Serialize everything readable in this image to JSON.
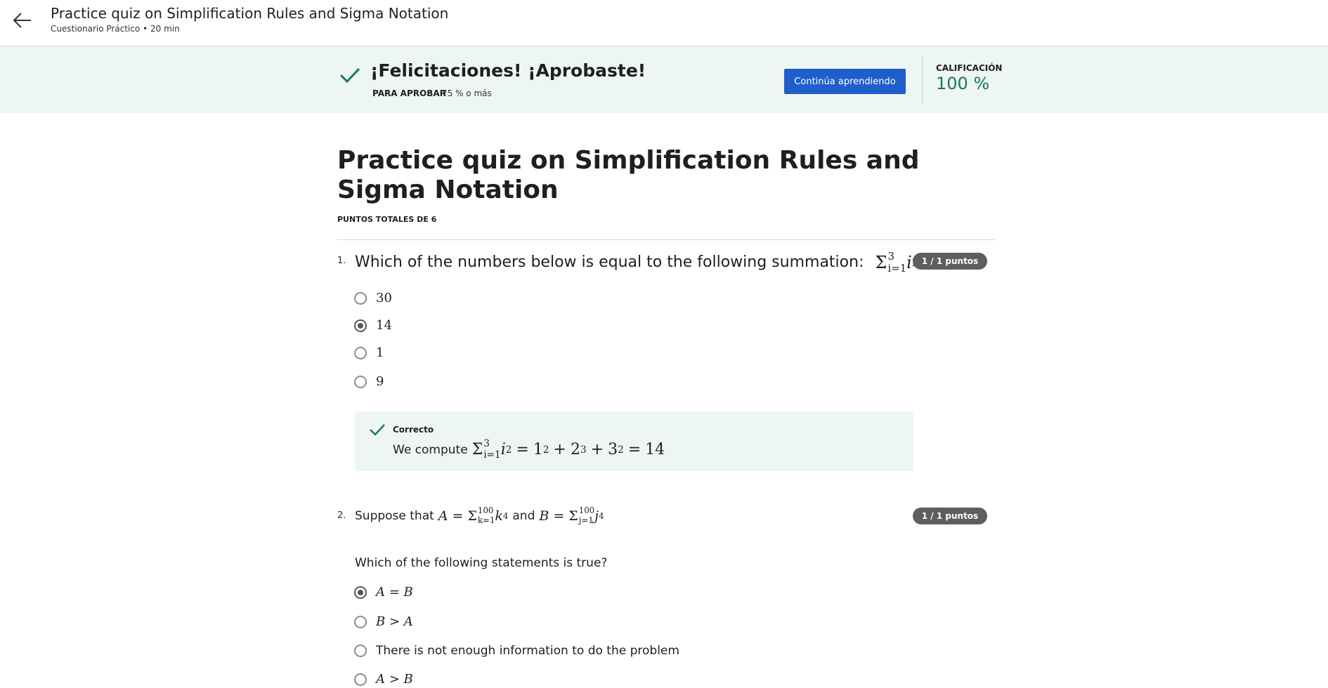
{
  "header": {
    "title": "Practice quiz on Simplification Rules and Sigma Notation",
    "subtitle": "Cuestionario Práctico • 20 min",
    "back_icon": "arrow-left-icon"
  },
  "banner": {
    "title": "¡Felicitaciones! ¡Aprobaste!",
    "pass_label": "PARA APROBAR",
    "pass_value": "75 % o más",
    "continue_label": "Continúa aprendiendo",
    "grade_label": "CALIFICACIÓN",
    "grade_value": "100 %",
    "accent": "#1a7a4c",
    "button_color": "#1f5fcc"
  },
  "quiz": {
    "title": "Practice quiz on Simplification Rules and Sigma Notation",
    "points_total": "PUNTOS TOTALES DE 6",
    "questions": [
      {
        "number": "1.",
        "prompt": "Which of the numbers below is equal to the following summation:",
        "prompt_math": {
          "sym": "Σ",
          "upper": "3",
          "lower": "i=1",
          "term": "i",
          "exp": "2"
        },
        "prompt_end": "?",
        "points": "1 / 1 puntos",
        "options": [
          {
            "label": "30",
            "selected": false
          },
          {
            "label": "14",
            "selected": true
          },
          {
            "label": "1",
            "selected": false
          },
          {
            "label": "9",
            "selected": false
          }
        ],
        "feedback": {
          "label": "Correcto",
          "text": "We compute",
          "math": {
            "sym": "Σ",
            "upper": "3",
            "lower": "i=1",
            "term": "i",
            "exp": "2",
            "eq": "=",
            "a": "1",
            "a_exp": "2",
            "plus1": "+",
            "b": "2",
            "b_exp": "3",
            "plus2": "+",
            "c": "3",
            "c_exp": "2",
            "eq2": "=",
            "result": "14"
          }
        }
      },
      {
        "number": "2.",
        "prompt_start": "Suppose that",
        "a_def": {
          "var": "A",
          "eq": "=",
          "sym": "Σ",
          "upper": "100",
          "lower": "k=1",
          "term": "k",
          "exp": "4"
        },
        "and": "and",
        "b_def": {
          "var": "B",
          "eq": "=",
          "sym": "Σ",
          "upper": "100",
          "lower": "j=1",
          "term": "j",
          "exp": "4"
        },
        "subprompt": "Which of the following statements is true?",
        "points": "1 / 1 puntos",
        "options": [
          {
            "label": "A = B",
            "selected": true
          },
          {
            "label": "B > A",
            "selected": false
          },
          {
            "label": "There is not enough information to do the problem",
            "selected": false
          },
          {
            "label": "A > B",
            "selected": false
          }
        ]
      }
    ]
  }
}
